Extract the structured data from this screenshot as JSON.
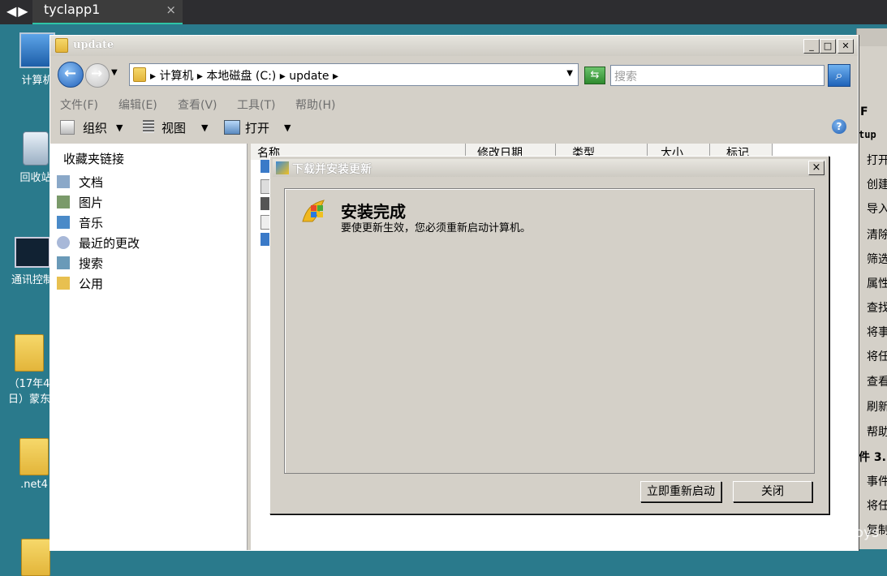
{
  "tabbar": {
    "nav_arrows": "◀▶",
    "tab_title": "tyclapp1",
    "tab_close": "×"
  },
  "desktop": {
    "icons": [
      {
        "label": "计算机"
      },
      {
        "label": "回收站"
      },
      {
        "label": "通讯控制"
      },
      {
        "label": "（17年4"
      },
      {
        "label": "日）蒙东"
      },
      {
        "label": ".net4"
      }
    ]
  },
  "background_window": {
    "items": [
      "F",
      "tup",
      "打开",
      "创建",
      "导入",
      "清除",
      "筛选",
      "属性",
      "查找",
      "将事",
      "将任",
      "查看",
      "刷新",
      "帮助",
      "件 3.",
      "事件",
      "将任",
      "复制"
    ]
  },
  "explorer": {
    "title": "update",
    "address": {
      "crumbs": "▸ 计算机 ▸ 本地磁盘 (C:) ▸ update ▸"
    },
    "search": {
      "placeholder": "搜索"
    },
    "menu": [
      "文件(F)",
      "编辑(E)",
      "查看(V)",
      "工具(T)",
      "帮助(H)"
    ],
    "toolbar": {
      "organize": "组织",
      "views": "视图",
      "open": "打开"
    },
    "nav": {
      "heading": "收藏夹链接",
      "items": [
        "文档",
        "图片",
        "音乐",
        "最近的更改",
        "搜索",
        "公用"
      ]
    },
    "columns": [
      "名称",
      "修改日期",
      "类型",
      "大小",
      "标记"
    ],
    "help_icon": "?"
  },
  "dialog": {
    "title": "下载并安装更新",
    "heading": "安装完成",
    "message": "要使更新生效，您必须重新启动计算机。",
    "restart_button": "立即重新启动",
    "close_button": "关闭",
    "close_x": "×"
  },
  "watermark": "CSDN @正在努力的boys"
}
